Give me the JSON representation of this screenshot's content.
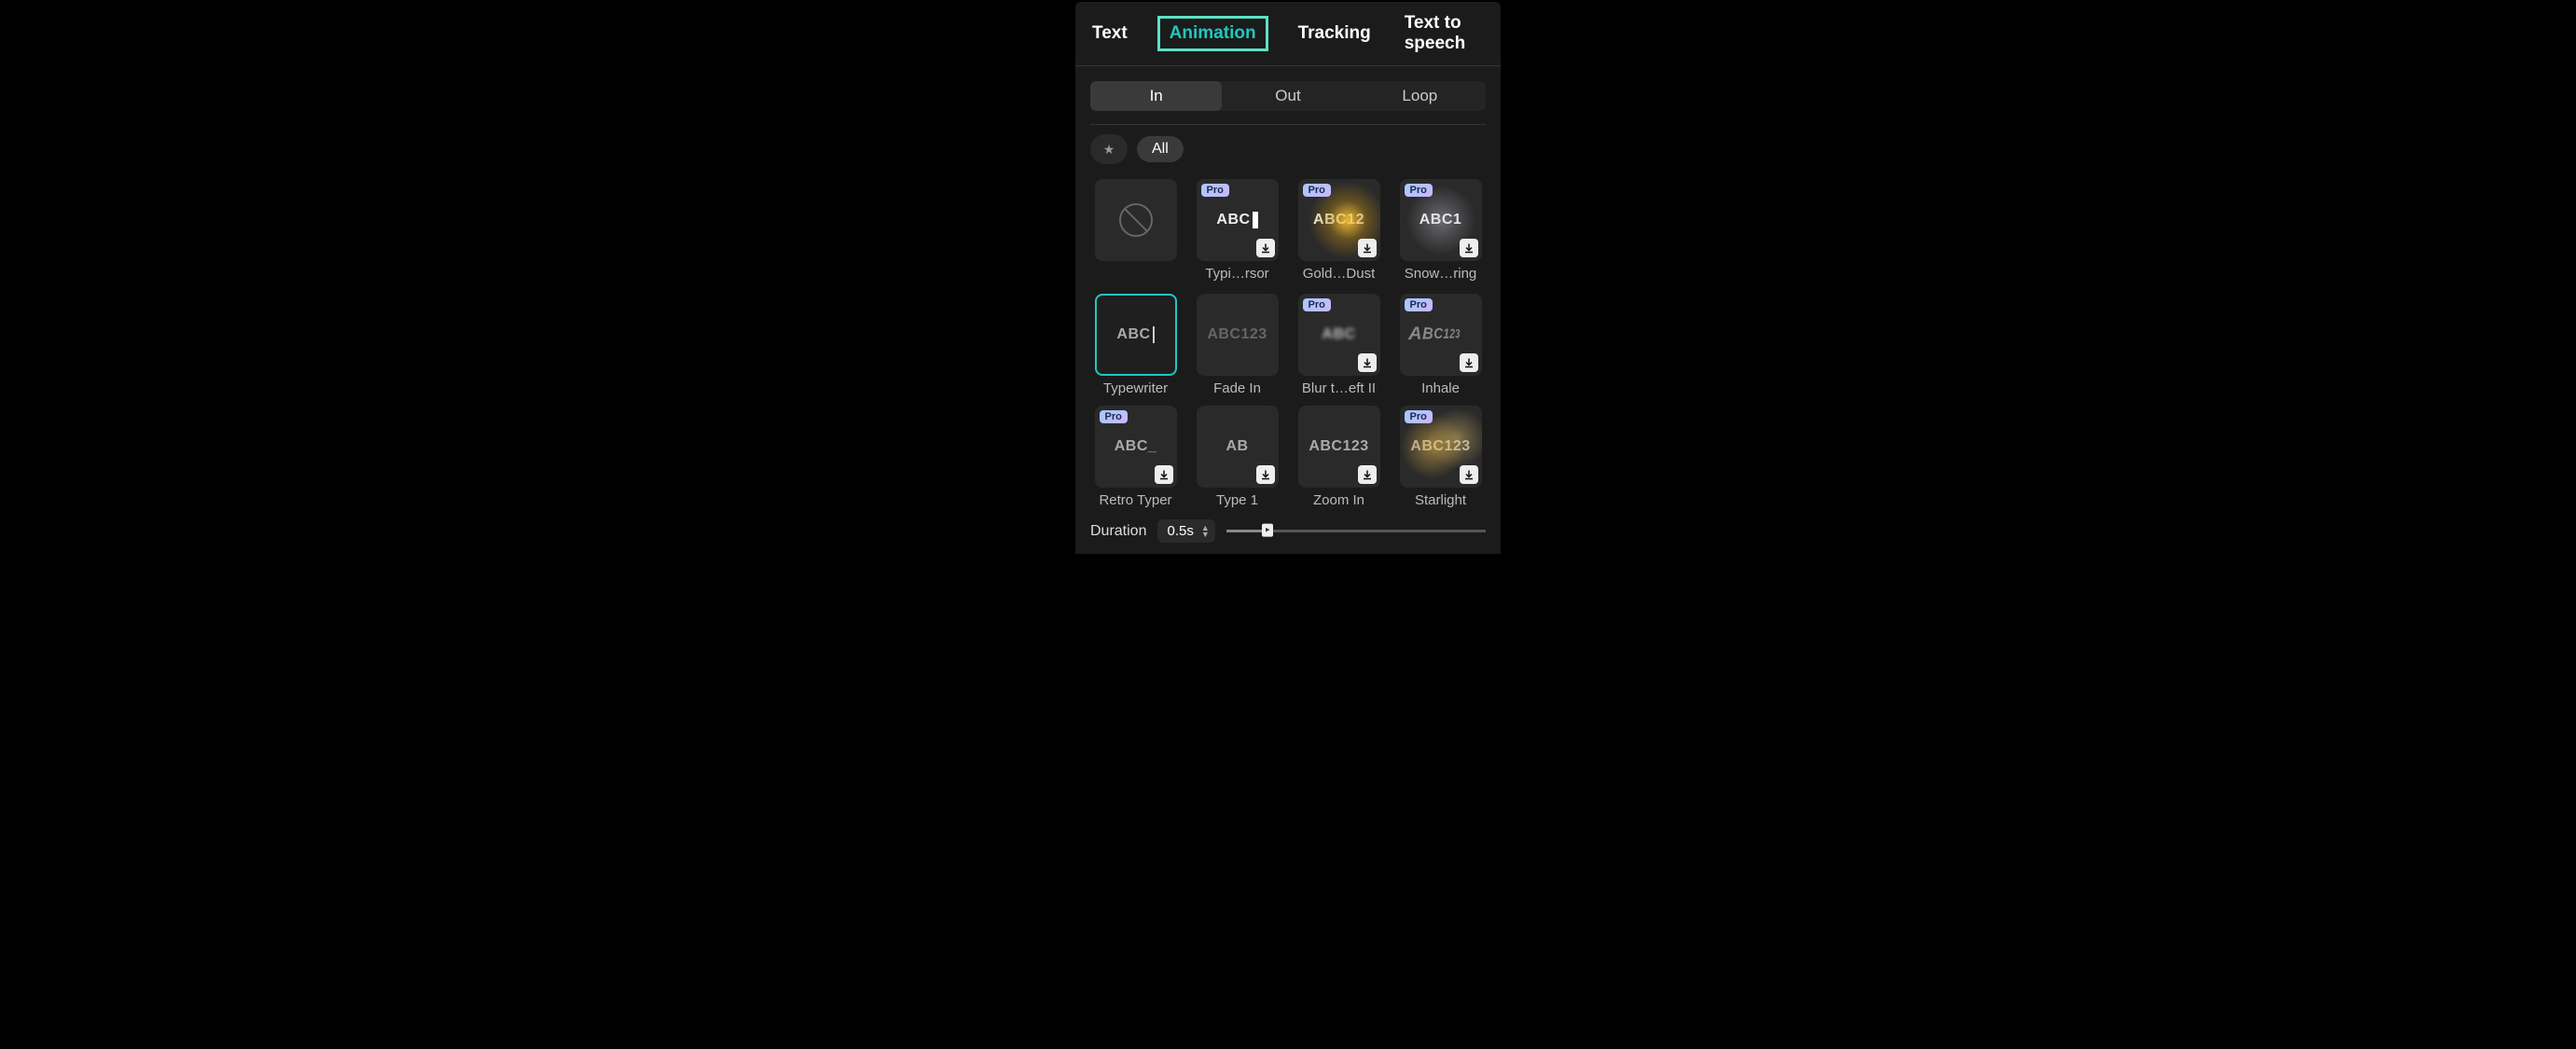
{
  "topTabs": {
    "text": "Text",
    "animation": "Animation",
    "tracking": "Tracking",
    "tts": "Text to speech"
  },
  "subTabs": {
    "in": "In",
    "out": "Out",
    "loop": "Loop"
  },
  "filters": {
    "all": "All"
  },
  "proBadge": "Pro",
  "items": [
    {
      "id": "none",
      "label": "",
      "preview": "",
      "pro": false,
      "download": false,
      "none": true,
      "selected": false
    },
    {
      "id": "typing",
      "label": "Typi…rsor",
      "preview": "ABC",
      "pro": true,
      "download": true,
      "cursor": "block",
      "bright": true
    },
    {
      "id": "golddust",
      "label": "Gold…Dust",
      "preview": "ABC12",
      "pro": true,
      "download": true,
      "effect": "gold",
      "bright": true
    },
    {
      "id": "snowring",
      "label": "Snow…ring",
      "preview": "ABC1",
      "pro": true,
      "download": true,
      "effect": "snow",
      "bright": true
    },
    {
      "id": "typewriter",
      "label": "Typewriter",
      "preview": "ABC",
      "pro": false,
      "download": false,
      "cursor": "thin",
      "selected": true
    },
    {
      "id": "fadein",
      "label": "Fade In",
      "preview": "ABC123",
      "pro": false,
      "download": false,
      "dim": true
    },
    {
      "id": "blurleft2",
      "label": "Blur t…eft II",
      "preview": "ABC",
      "pro": true,
      "download": true,
      "blur": true
    },
    {
      "id": "inhale",
      "label": "Inhale",
      "preview": "ABC123",
      "pro": true,
      "download": true,
      "perspective": true
    },
    {
      "id": "retrotyper",
      "label": "Retro Typer",
      "preview": "ABC_",
      "pro": true,
      "download": true
    },
    {
      "id": "type1",
      "label": "Type 1",
      "preview": "AB",
      "pro": false,
      "download": true
    },
    {
      "id": "zoomin",
      "label": "Zoom In",
      "preview": "ABC123",
      "pro": false,
      "download": true
    },
    {
      "id": "starlight",
      "label": "Starlight",
      "preview": "ABC123",
      "pro": true,
      "download": true,
      "effect": "star"
    }
  ],
  "duration": {
    "label": "Duration",
    "value": "0.5s"
  }
}
